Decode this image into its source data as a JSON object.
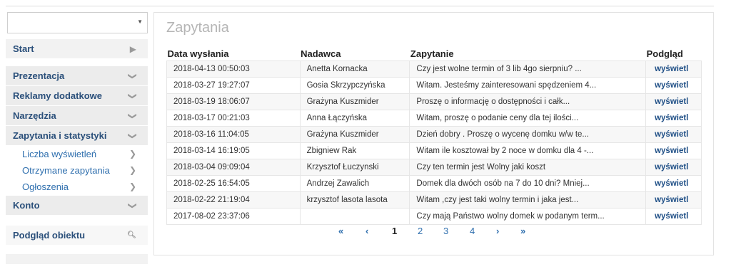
{
  "sidebar": {
    "select_value": "",
    "start": "Start",
    "menu": [
      {
        "label": "Prezentacja"
      },
      {
        "label": "Reklamy dodatkowe"
      },
      {
        "label": "Narzędzia"
      },
      {
        "label": "Zapytania i statystyki"
      }
    ],
    "submenu": [
      {
        "label": "Liczba wyświetleń"
      },
      {
        "label": "Otrzymane zapytania"
      },
      {
        "label": "Ogłoszenia"
      }
    ],
    "konto": "Konto",
    "preview": "Podgląd obiektu"
  },
  "main": {
    "title": "Zapytania",
    "columns": [
      "Data wysłania",
      "Nadawca",
      "Zapytanie",
      "Podgląd"
    ],
    "rows": [
      {
        "date": "2018-04-13 00:50:03",
        "sender": "Anetta Kornacka",
        "query": "Czy jest wolne termin of 3 lib 4go sierpniu? ...",
        "view": "wyświetl"
      },
      {
        "date": "2018-03-27 19:27:07",
        "sender": "Gosia Skrzypczyńska",
        "query": "Witam. Jesteśmy zainteresowani spędzeniem 4...",
        "view": "wyświetl"
      },
      {
        "date": "2018-03-19 18:06:07",
        "sender": "Grażyna Kuszmider",
        "query": "Proszę o informację o dostępności i całk...",
        "view": "wyświetl"
      },
      {
        "date": "2018-03-17 00:21:03",
        "sender": "Anna Łączyńska",
        "query": "Witam, proszę o podanie ceny dla tej ilości...",
        "view": "wyświetl"
      },
      {
        "date": "2018-03-16 11:04:05",
        "sender": "Grażyna Kuszmider",
        "query": "Dzień dobry . Proszę o wycenę domku w/w te...",
        "view": "wyświetl"
      },
      {
        "date": "2018-03-14 16:19:05",
        "sender": "Zbigniew Rak",
        "query": "Witam ile kosztował by 2 noce w domku dla 4 -...",
        "view": "wyświetl"
      },
      {
        "date": "2018-03-04 09:09:04",
        "sender": "Krzysztof Łuczynski",
        "query": "Czy ten termin jest Wolny jaki koszt",
        "view": "wyświetl"
      },
      {
        "date": "2018-02-25 16:54:05",
        "sender": "Andrzej Zawalich",
        "query": "Domek dla dwóch osób na 7 do 10 dni? Mniej...",
        "view": "wyświetl"
      },
      {
        "date": "2018-02-22 21:19:04",
        "sender": "krzysztof lasota lasota",
        "query": "Witam ,czy jest taki wolny termin i jaka jest...",
        "view": "wyświetl"
      },
      {
        "date": "2017-08-02 23:37:06",
        "sender": "",
        "query": "Czy mają Państwo wolny domek w podanym term...",
        "view": "wyświetl"
      }
    ]
  },
  "pagination": {
    "first": "«",
    "prev": "‹",
    "pages": [
      "1",
      "2",
      "3",
      "4"
    ],
    "next": "›",
    "last": "»",
    "current": "1"
  }
}
